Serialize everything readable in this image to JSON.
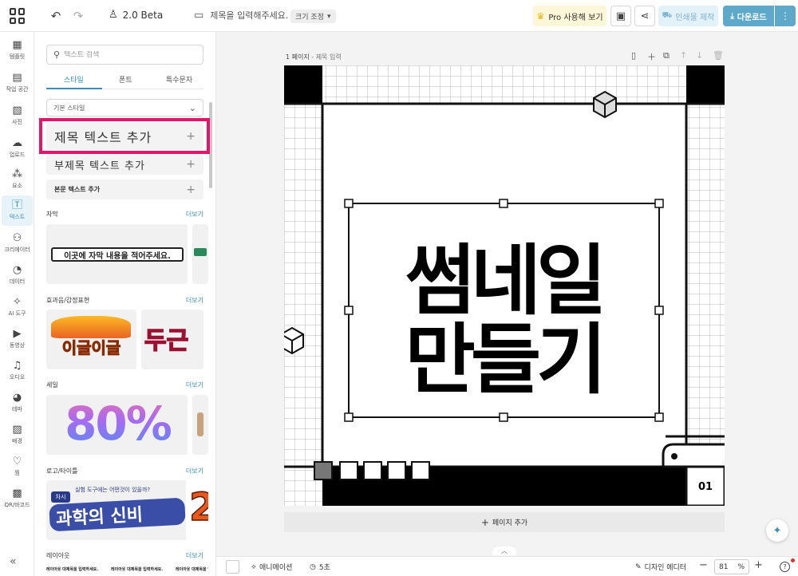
{
  "topbar": {
    "version": "2.0 Beta",
    "doc_title": "제목을 입력해주세요.",
    "size_button": "크기 조정",
    "pro_label": "Pro 사용해 보기",
    "print_label": "인쇄물 제작",
    "download_label": "다운로드",
    "more_label": "⋮"
  },
  "rail": {
    "items": [
      {
        "label": "템플릿",
        "icon": "template-icon"
      },
      {
        "label": "작업 공간",
        "icon": "archive-icon"
      },
      {
        "label": "사진",
        "icon": "image-icon"
      },
      {
        "label": "업로드",
        "icon": "upload-cloud-icon"
      },
      {
        "label": "요소",
        "icon": "elements-icon"
      },
      {
        "label": "텍스트",
        "icon": "text-icon"
      },
      {
        "label": "크리에이터",
        "icon": "creator-icon"
      },
      {
        "label": "데이터",
        "icon": "chart-icon"
      },
      {
        "label": "AI 도구",
        "icon": "sparkle-icon"
      },
      {
        "label": "동영상",
        "icon": "play-icon"
      },
      {
        "label": "오디오",
        "icon": "music-icon"
      },
      {
        "label": "테마",
        "icon": "palette-icon"
      },
      {
        "label": "배경",
        "icon": "pattern-icon"
      },
      {
        "label": "찜",
        "icon": "heart-icon"
      },
      {
        "label": "QR/바코드",
        "icon": "qr-icon"
      }
    ],
    "collapse": "«"
  },
  "panel": {
    "search_placeholder": "텍스트 검색",
    "tabs": [
      "스타일",
      "폰트",
      "특수문자"
    ],
    "style_select": "기본 스타일",
    "add_heading": "제목 텍스트 추가",
    "add_subheading": "부제목 텍스트 추가",
    "add_body": "본문 텍스트 추가",
    "more": "더보기",
    "sections": [
      {
        "title": "자막",
        "sample": "이곳에 자막 내용을 적어주세요."
      },
      {
        "title": "효과음/감정표현",
        "sample": "이글이글",
        "sample2": "두근"
      },
      {
        "title": "세일",
        "sample": "80%"
      },
      {
        "title": "로고/타이틀",
        "sample_top": "실험 도구에는 어떤것이 있을까?",
        "sample": "과학의 신비",
        "badge": "차시",
        "sample2": "2"
      },
      {
        "title": "레이아웃",
        "sample": "레이아웃 대제목을 입력하세요."
      }
    ]
  },
  "canvas": {
    "page_label": "1 페이지",
    "page_sublabel": " - 제목 입력",
    "headline_line1": "썸네일",
    "headline_line2": "만들기",
    "page_number": "01",
    "add_page": "페이지 추가"
  },
  "bottombar": {
    "animation": "애니메이션",
    "duration": "5초",
    "design_editor": "디자인 에디터",
    "zoom_value": "81",
    "zoom_unit": "%",
    "help": "?"
  },
  "colors": {
    "accent": "#3d8fb8",
    "highlight": "#e6136b",
    "download": "#5ea8c9",
    "pro_bg": "#fdf6d8"
  }
}
